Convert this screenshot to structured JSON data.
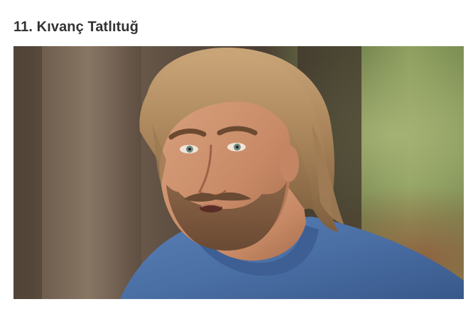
{
  "article": {
    "heading": "11. Kıvanç Tatlıtuğ"
  },
  "photo": {
    "subject": "portrait-photo"
  },
  "colors": {
    "heading_text": "#333333",
    "page_background": "#ffffff",
    "shirt_blue": "#4a6fa5",
    "hair": "#b08a5a",
    "forest_green": "#6f8a55"
  }
}
